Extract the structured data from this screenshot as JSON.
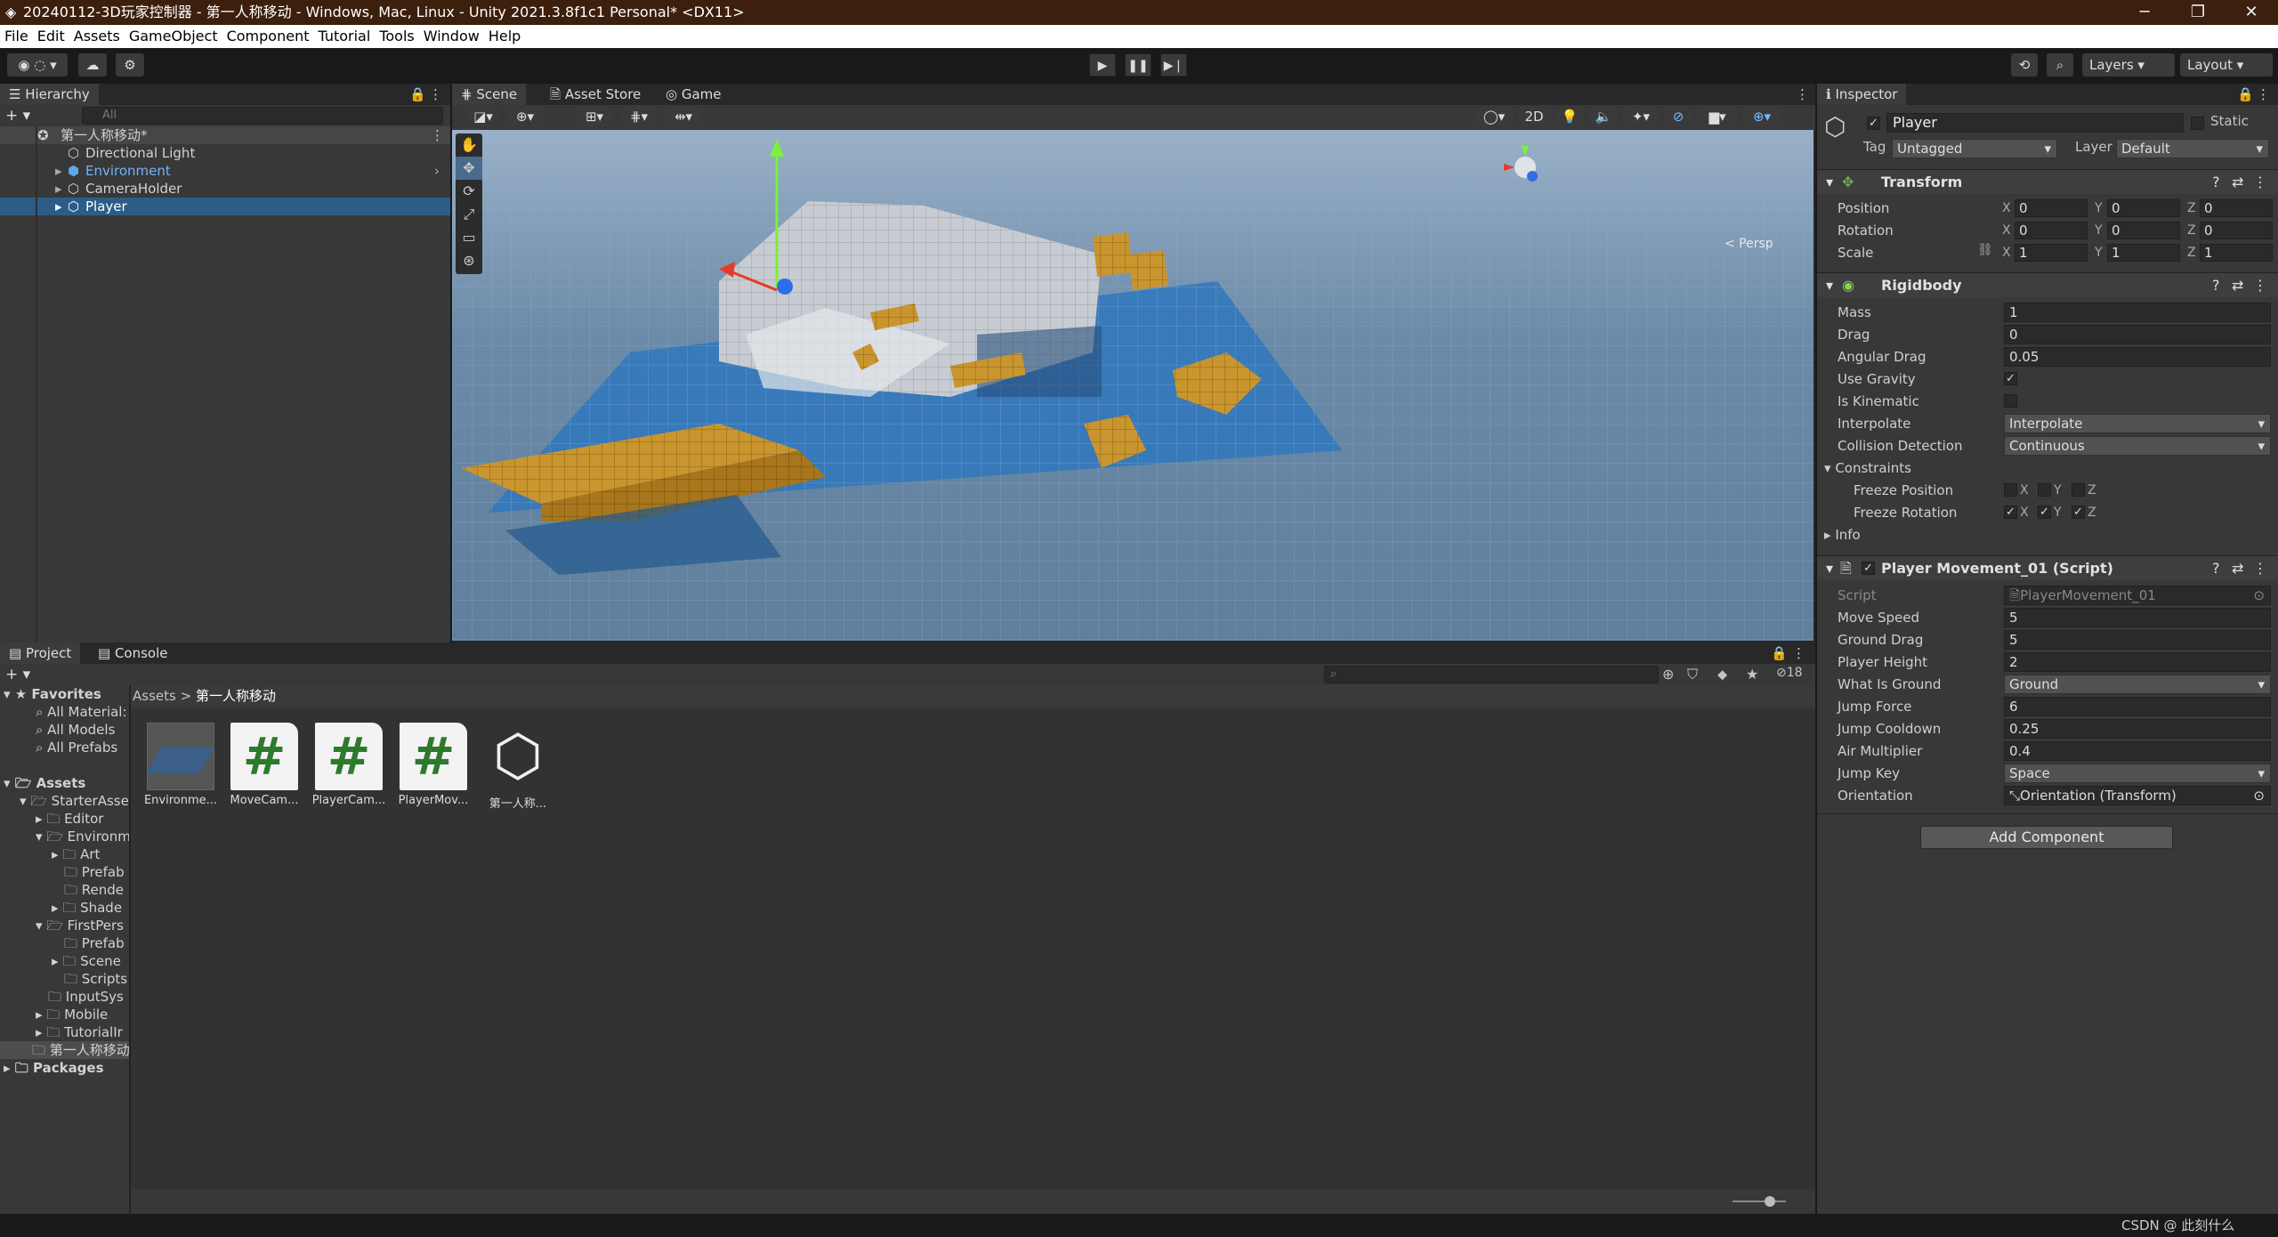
{
  "window": {
    "title": "20240112-3D玩家控制器 - 第一人称移动 - Windows, Mac, Linux - Unity 2021.3.8f1c1 Personal* <DX11>",
    "min": "─",
    "max": "❐",
    "close": "✕"
  },
  "menu": [
    "File",
    "Edit",
    "Assets",
    "GameObject",
    "Component",
    "Tutorial",
    "Tools",
    "Window",
    "Help"
  ],
  "toolbar": {
    "layers": "Layers",
    "layout": "Layout",
    "play": "▶",
    "pause": "❚❚",
    "step": "▶❘"
  },
  "hierarchy": {
    "tab": "Hierarchy",
    "search_placeholder": "All",
    "scene": "第一人称移动*",
    "items": [
      "Directional Light",
      "Environment",
      "CameraHolder",
      "Player"
    ]
  },
  "scene_tabs": {
    "scene": "Scene",
    "asset_store": "Asset Store",
    "game": "Game",
    "mode_2d": "2D",
    "persp": "< Persp"
  },
  "inspector": {
    "tab": "Inspector",
    "object_name": "Player",
    "static_label": "Static",
    "tag_label": "Tag",
    "tag_value": "Untagged",
    "layer_label": "Layer",
    "layer_value": "Default",
    "transform": {
      "title": "Transform",
      "position_label": "Position",
      "rotation_label": "Rotation",
      "scale_label": "Scale",
      "position": [
        "0",
        "0",
        "0"
      ],
      "rotation": [
        "0",
        "0",
        "0"
      ],
      "scale": [
        "1",
        "1",
        "1"
      ]
    },
    "rigidbody": {
      "title": "Rigidbody",
      "rows": [
        [
          "Mass",
          "1"
        ],
        [
          "Drag",
          "0"
        ],
        [
          "Angular Drag",
          "0.05"
        ]
      ],
      "use_gravity": "Use Gravity",
      "is_kinematic": "Is Kinematic",
      "interpolate_label": "Interpolate",
      "interpolate": "Interpolate",
      "collision_label": "Collision Detection",
      "collision": "Continuous",
      "constraints": "Constraints",
      "freeze_pos": "Freeze Position",
      "freeze_rot": "Freeze Rotation",
      "info": "Info"
    },
    "script": {
      "title": "Player Movement_01 (Script)",
      "script_label": "Script",
      "script_value": "PlayerMovement_01",
      "rows": [
        [
          "Move Speed",
          "5"
        ],
        [
          "Ground Drag",
          "5"
        ],
        [
          "Player Height",
          "2"
        ]
      ],
      "what_is_ground": "What Is Ground",
      "ground_value": "Ground",
      "rows2": [
        [
          "Jump Force",
          "6"
        ],
        [
          "Jump Cooldown",
          "0.25"
        ],
        [
          "Air Multiplier",
          "0.4"
        ]
      ],
      "jump_key": "Jump Key",
      "jump_key_value": "Space",
      "orientation": "Orientation",
      "orientation_value": "Orientation (Transform)"
    },
    "add_component": "Add Component"
  },
  "project": {
    "tab": "Project",
    "console_tab": "Console",
    "count": "18",
    "breadcrumb_root": "Assets",
    "breadcrumb_sep": ">",
    "breadcrumb_current": "第一人称移动",
    "favorites": "Favorites",
    "fav_items": [
      "All Material:",
      "All Models",
      "All Prefabs"
    ],
    "assets_root": "Assets",
    "tree": [
      "StarterAsse",
      "Editor",
      "Environm",
      "Art",
      "Prefab",
      "Rende",
      "Shade",
      "FirstPers",
      "Prefab",
      "Scene",
      "Scripts",
      "InputSys",
      "Mobile",
      "TutorialIr",
      "第一人称移动"
    ],
    "packages": "Packages",
    "assets": [
      "Environme...",
      "MoveCam...",
      "PlayerCam...",
      "PlayerMov...",
      "第一人称..."
    ]
  },
  "status": {
    "watermark": "CSDN @ 此刻什么"
  }
}
